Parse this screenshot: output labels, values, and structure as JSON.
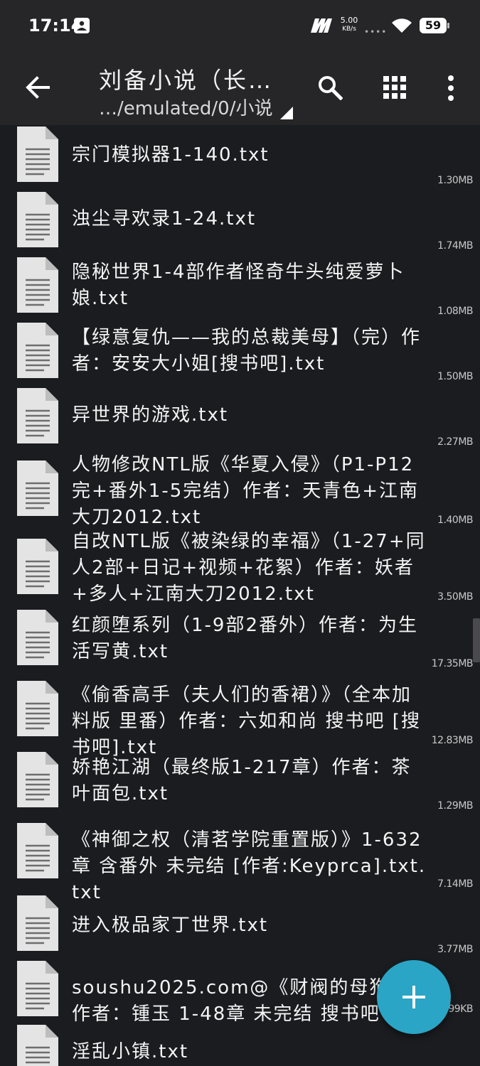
{
  "status_bar": {
    "time": "17:14",
    "net_speed_value": "5.00",
    "net_speed_unit": "KB/s",
    "battery": "59",
    "icons": [
      "photo-notification-icon",
      "m-app-icon",
      "signal-dots-icon",
      "wifi-icon",
      "battery-icon"
    ]
  },
  "toolbar": {
    "title": "刘备小说（长…",
    "path": "…/emulated/0/小说",
    "icons": [
      "back-arrow-icon",
      "search-icon",
      "grid-view-icon",
      "more-vert-icon",
      "dropdown-triangle-icon"
    ]
  },
  "files": [
    {
      "name": "宗门模拟器1-140.txt",
      "size": "1.30MB"
    },
    {
      "name": "浊尘寻欢录1-24.txt",
      "size": "1.74MB"
    },
    {
      "name": "隐秘世界1-4部作者怪奇牛头纯爱萝卜娘.txt",
      "size": "1.08MB"
    },
    {
      "name": "【绿意复仇——我的总裁美母】（完）作者：安安大小姐[搜书吧].txt",
      "size": "1.50MB"
    },
    {
      "name": "异世界的游戏.txt",
      "size": "2.27MB"
    },
    {
      "name": "人物修改NTL版《华夏入侵》（P1-P12完+番外1-5完结）作者：天青色+江南大刀2012.txt",
      "size": "1.40MB"
    },
    {
      "name": "自改NTL版《被染绿的幸福》（1-27+同人2部+日记+视频+花絮）作者：妖者+多人+江南大刀2012.txt",
      "size": "3.50MB"
    },
    {
      "name": "红颜堕系列（1-9部2番外）作者：为生活写黄.txt",
      "size": "17.35MB"
    },
    {
      "name": "《偷香高手（夫人们的香裙）》（全本加料版 里番）作者：六如和尚 搜书吧 [搜书吧].txt",
      "size": "12.83MB"
    },
    {
      "name": "娇艳江湖（最终版1-217章）作者：茶叶面包.txt",
      "size": "1.29MB"
    },
    {
      "name": "《神御之权（清茗学院重置版）》1-632章 含番外 未完结 [作者:Keyprca].txt.txt",
      "size": "7.14MB"
    },
    {
      "name": "进入极品家丁世界.txt",
      "size": "3.77MB"
    },
    {
      "name": "soushu2025.com@《财阀的母狗们》作者：锺玉 1-48章 未完结 搜书吧",
      "size": ".99KB"
    },
    {
      "name": "淫乱小镇.txt",
      "size": ""
    }
  ],
  "colors": {
    "background": "#1b1c20",
    "toolbar": "#262628",
    "fab": "#2aa5c6",
    "file_icon": "#e4e4e4"
  }
}
